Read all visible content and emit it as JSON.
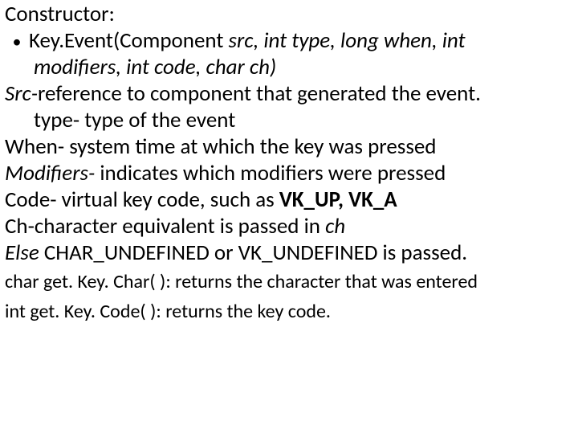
{
  "l1": "Constructor:",
  "bullet_glyph": "•",
  "l2a_plain": "Key.Event(Component ",
  "l2a_ital": "src, int type, long when, int",
  "l2b_ital": "modifiers, int code, char ch)",
  "l3_ital": "Src-",
  "l3_plain": "reference to component that generated the event.",
  "l4": "type- type of the event",
  "l5": "When- system time at which the key was pressed",
  "l6_ital": "Modifiers- ",
  "l6_plain": "indicates which modifiers were pressed",
  "l7_plain1": "Code- virtual key code, such as ",
  "l7_bold": "VK_UP, VK_A",
  "l8_plain1": "Ch-character equivalent is passed in ",
  "l8_ital": "ch",
  "l9_ital": "Else ",
  "l9_plain": "CHAR_UNDEFINED or VK_UNDEFINED is passed.",
  "l10": "char get. Key. Char( ): returns the character that was entered",
  "l11": "int get. Key. Code( ): returns the key code."
}
